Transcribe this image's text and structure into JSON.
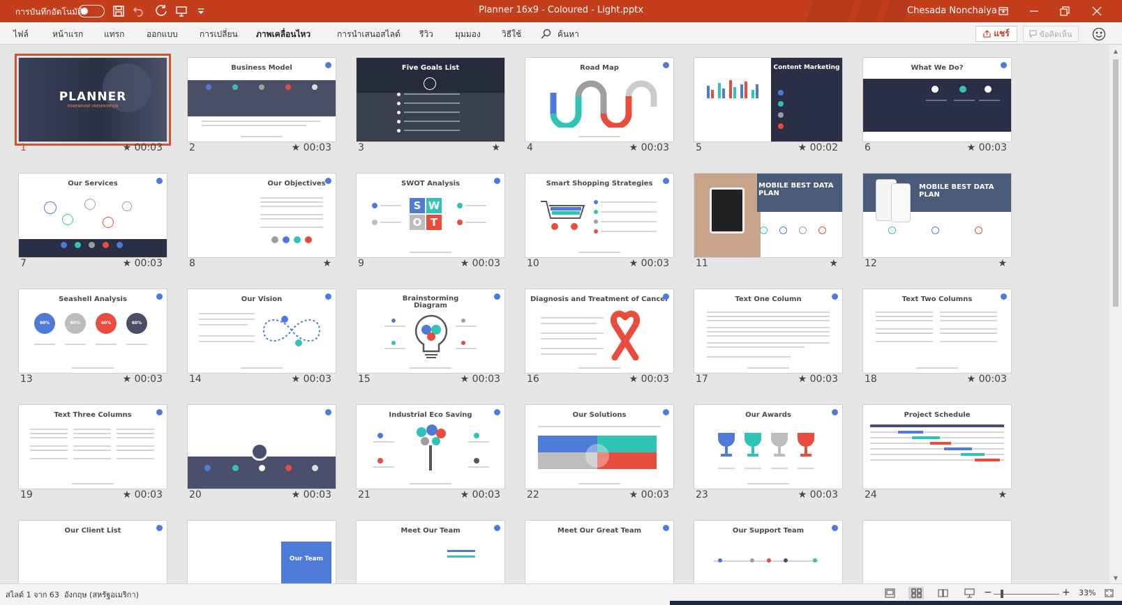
{
  "titlebar": {
    "autosave_label": "การบันทึกอัตโนมัติ",
    "autosave_state": "off",
    "document_title": "Planner 16x9 - Coloured - Light.pptx",
    "user_name": "Chesada Nonchaiya"
  },
  "ribbon": {
    "tabs": [
      {
        "label": "ไฟล์",
        "active": false
      },
      {
        "label": "หน้าแรก",
        "active": false
      },
      {
        "label": "แทรก",
        "active": false
      },
      {
        "label": "ออกแบบ",
        "active": false
      },
      {
        "label": "การเปลี่ยน",
        "active": false
      },
      {
        "label": "ภาพเคลื่อนไหว",
        "active": true
      },
      {
        "label": "การนำเสนอสไลด์",
        "active": false
      },
      {
        "label": "รีวิว",
        "active": false
      },
      {
        "label": "มุมมอง",
        "active": false
      },
      {
        "label": "วิธีใช้",
        "active": false
      }
    ],
    "search_label": "ค้นหา",
    "share_label": "แชร์",
    "comments_label": "ข้อคิดเห็น"
  },
  "slides": [
    {
      "number": "1",
      "title": "PLANNER",
      "subtitle": "POWERPOINT PRESENTATION",
      "time": "★ 00:03",
      "selected": true
    },
    {
      "number": "2",
      "title": "Business Model",
      "time": "★ 00:03"
    },
    {
      "number": "3",
      "title": "Five Goals List",
      "time": "★"
    },
    {
      "number": "4",
      "title": "Road Map",
      "time": "★ 00:03"
    },
    {
      "number": "5",
      "title": "Content Marketing",
      "time": "★ 00:02"
    },
    {
      "number": "6",
      "title": "What We Do?",
      "time": "★ 00:03"
    },
    {
      "number": "7",
      "title": "Our Services",
      "time": "★ 00:03"
    },
    {
      "number": "8",
      "title": "Our Objectives",
      "time": "★"
    },
    {
      "number": "9",
      "title": "SWOT Analysis",
      "time": "★ 00:03",
      "letters": [
        "S",
        "W",
        "O",
        "T"
      ]
    },
    {
      "number": "10",
      "title": "Smart Shopping Strategies",
      "time": "★ 00:03"
    },
    {
      "number": "11",
      "title": "MOBILE BEST DATA PLAN",
      "time": "★"
    },
    {
      "number": "12",
      "title": "MOBILE BEST DATA PLAN",
      "time": "★"
    },
    {
      "number": "13",
      "title": "Seashell Analysis",
      "time": "★ 00:03",
      "percents": [
        "60%",
        "60%",
        "60%",
        "60%"
      ]
    },
    {
      "number": "14",
      "title": "Our Vision",
      "time": "★ 00:03"
    },
    {
      "number": "15",
      "title": "Brainstorming Diagram",
      "time": "★ 00:03"
    },
    {
      "number": "16",
      "title": "Diagnosis and Treatment of Cancer",
      "time": "★ 00:03"
    },
    {
      "number": "17",
      "title": "Text One Column",
      "time": "★ 00:03"
    },
    {
      "number": "18",
      "title": "Text Two Columns",
      "time": "★ 00:03"
    },
    {
      "number": "19",
      "title": "Text Three Columns",
      "time": "★ 00:03"
    },
    {
      "number": "20",
      "title": "",
      "time": "★ 00:03"
    },
    {
      "number": "21",
      "title": "Industrial Eco Saving",
      "time": "★ 00:03"
    },
    {
      "number": "22",
      "title": "Our Solutions",
      "time": "★ 00:03"
    },
    {
      "number": "23",
      "title": "Our Awards",
      "time": "★ 00:03"
    },
    {
      "number": "24",
      "title": "Project Schedule",
      "time": "★"
    },
    {
      "number": "",
      "title": "Our Client List",
      "time": ""
    },
    {
      "number": "",
      "title": "Our Team",
      "time": ""
    },
    {
      "number": "",
      "title": "Meet Our Team",
      "time": ""
    },
    {
      "number": "",
      "title": "Meet Our Great Team",
      "time": ""
    },
    {
      "number": "",
      "title": "Our Support Team",
      "time": ""
    },
    {
      "number": "",
      "title": "",
      "time": ""
    }
  ],
  "statusbar": {
    "slide_count": "สไลด์ 1 จาก 63",
    "language": "อังกฤษ (สหรัฐอเมริกา)",
    "zoom_minus": "−",
    "zoom_plus": "+",
    "zoom_level": "33%"
  },
  "colors": {
    "accent": "#c43e1c",
    "selection": "#d35230",
    "navy": "#2b2f45",
    "teal": "#2ec4b6",
    "blue": "#4f7bd8",
    "red": "#e84c3d",
    "grey": "#9e9e9e"
  }
}
